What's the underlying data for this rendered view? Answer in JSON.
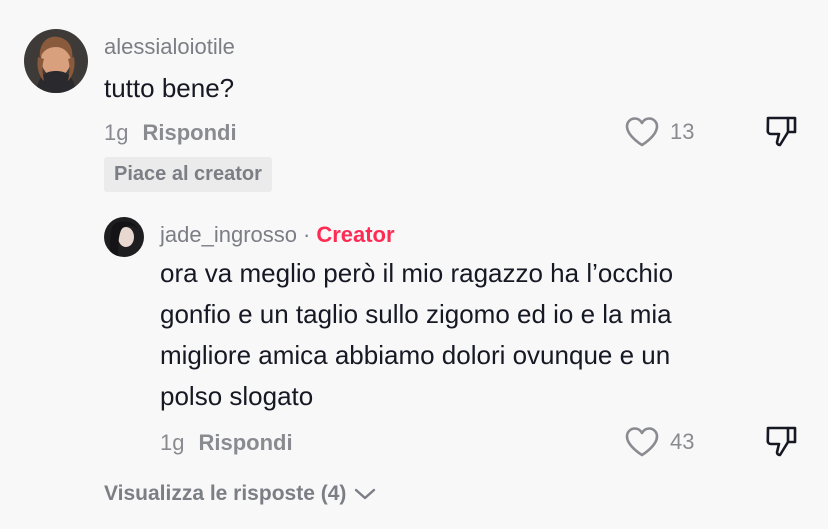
{
  "comment": {
    "username": "alessialoiotile",
    "text": "tutto bene?",
    "time": "1g",
    "reply_label": "Rispondi",
    "likes": "13",
    "badge": "Piace al creator"
  },
  "reply": {
    "username": "jade_ingrosso",
    "separator": "·",
    "creator_tag": "Creator",
    "text": "ora va meglio però il mio ragazzo ha l’occhio gonfio e un taglio sullo zigomo ed io e la mia migliore amica abbiamo dolori ovunque e un polso slogato",
    "time": "1g",
    "reply_label": "Rispondi",
    "likes": "43"
  },
  "view_replies": {
    "label": "Visualizza le risposte (4)"
  },
  "colors": {
    "background": "#f8f8f8",
    "creator_accent": "#fe2c55",
    "secondary_text": "#8a8b91"
  }
}
